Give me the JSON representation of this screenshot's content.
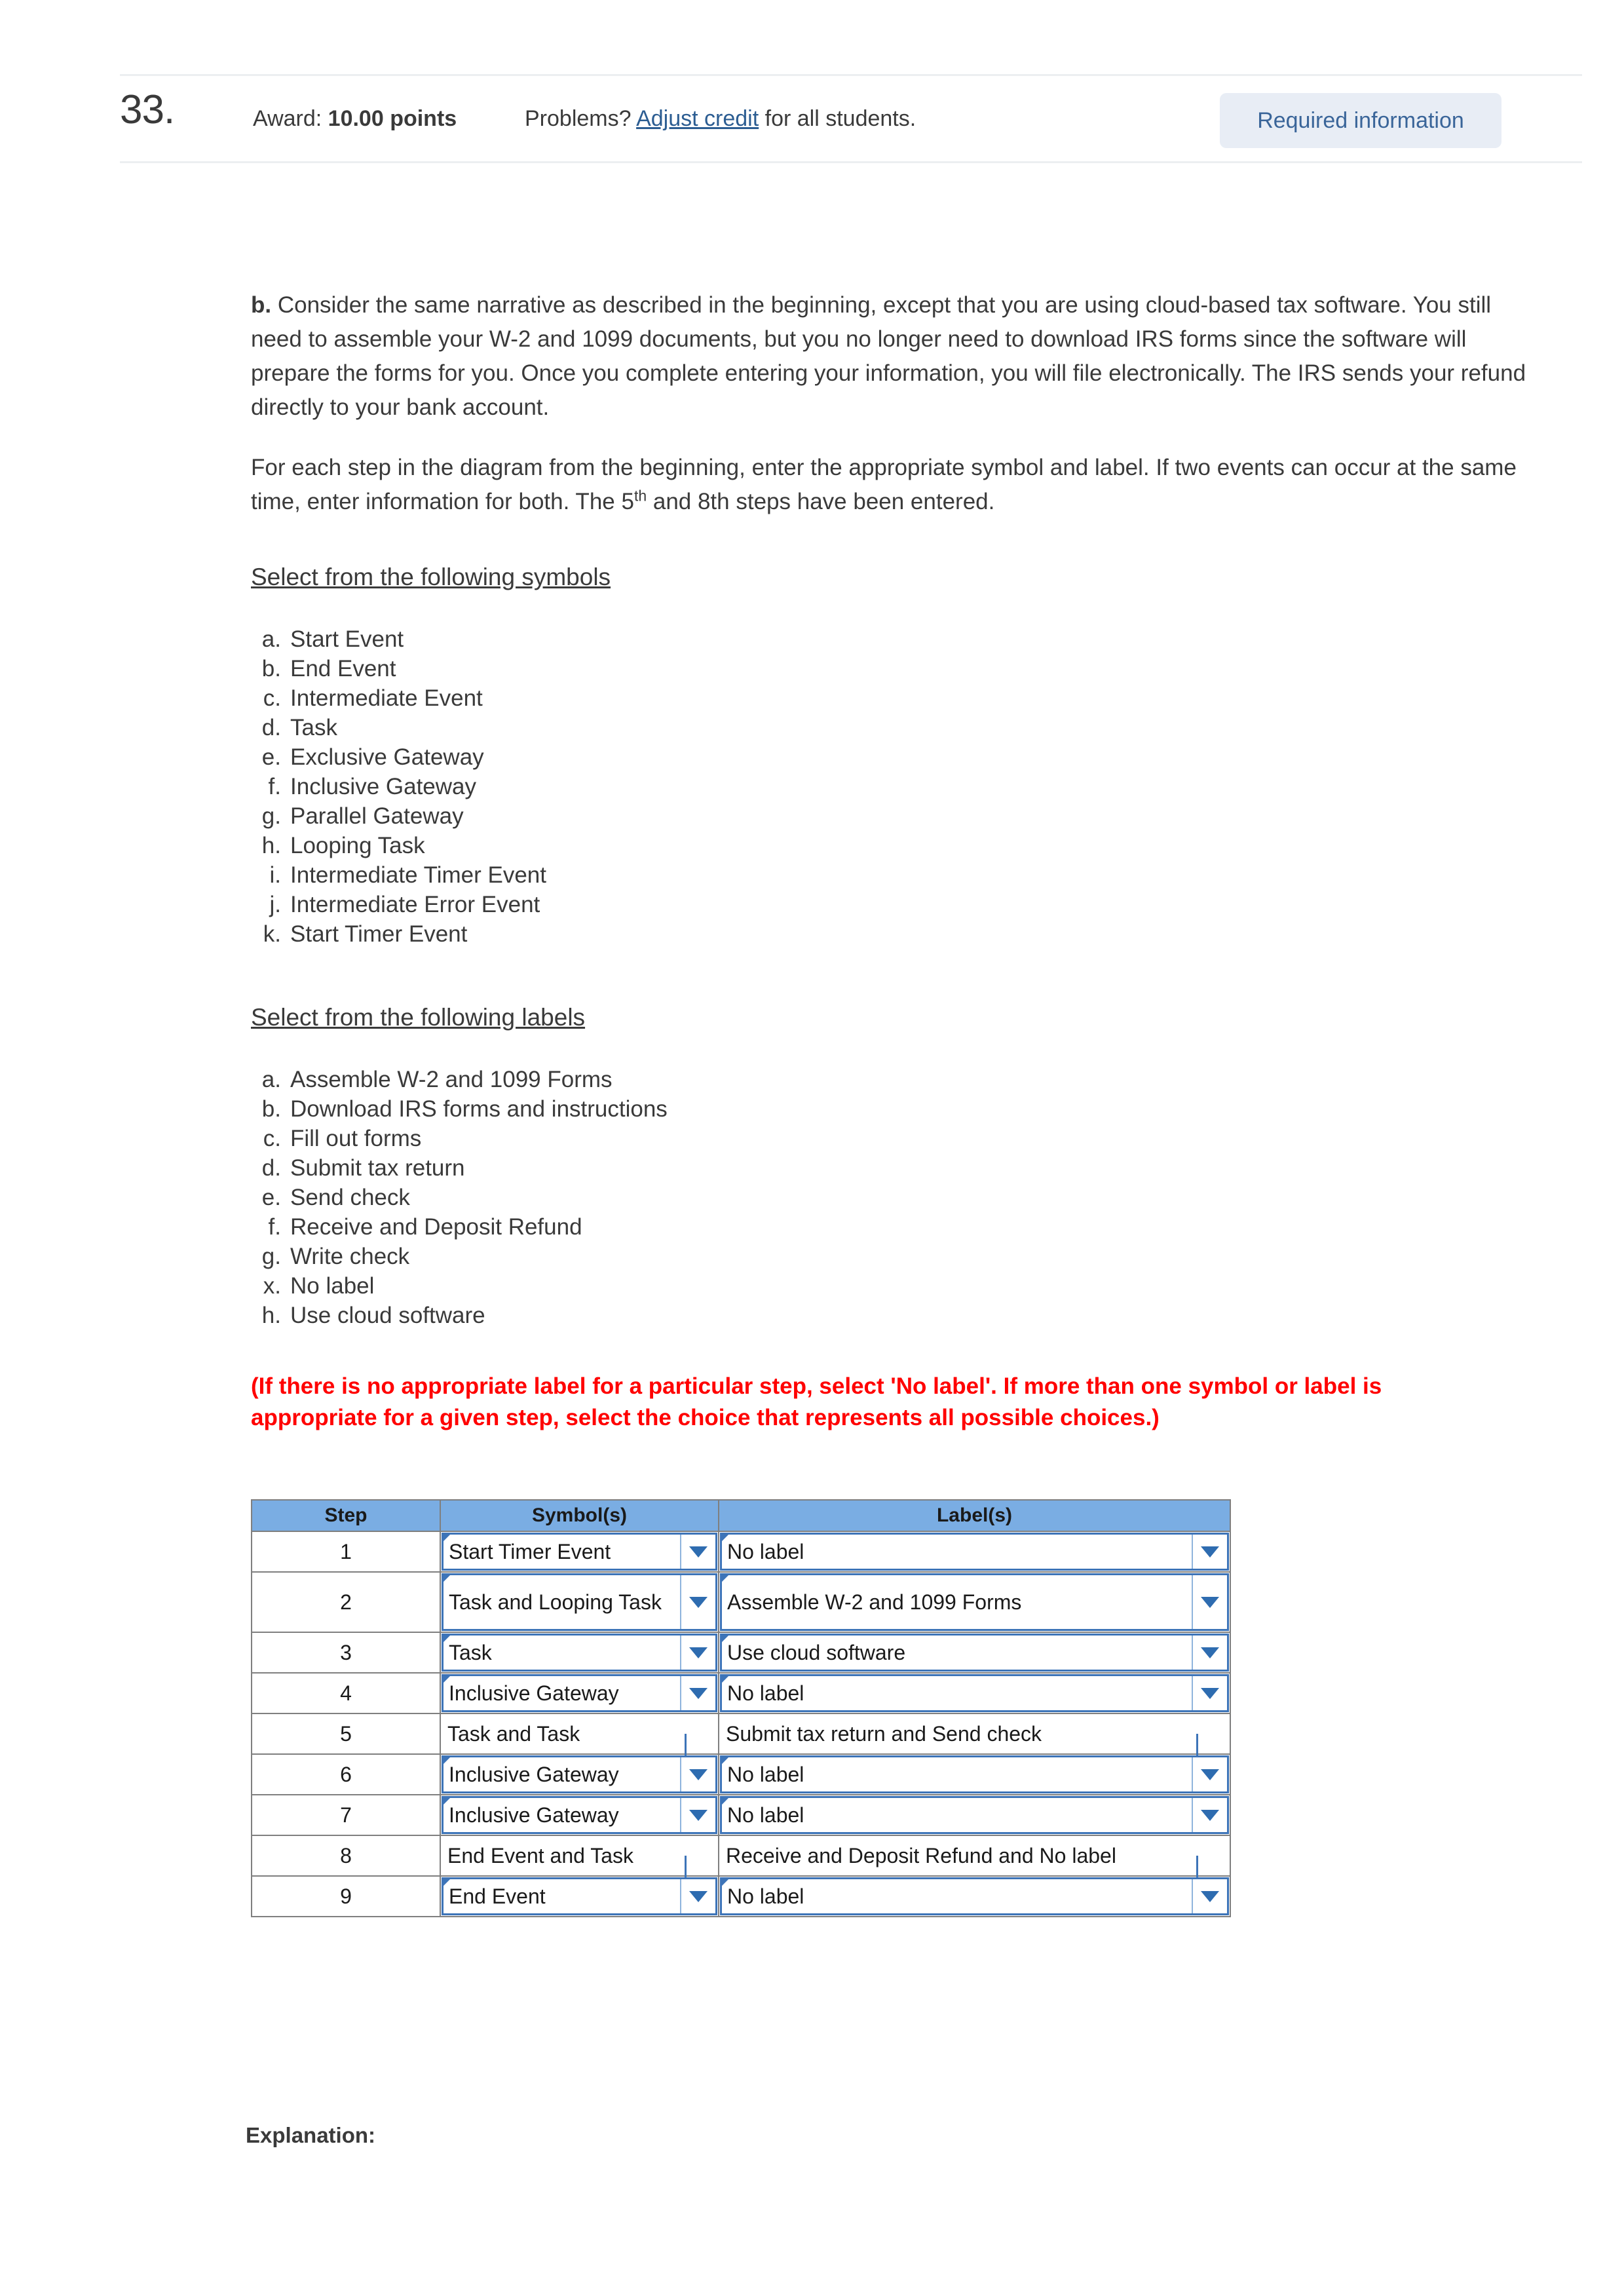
{
  "header": {
    "question_number": "33.",
    "award_prefix": "Award:",
    "award_value": "10.00 points",
    "problems_prefix": "Problems?",
    "adjust_link": "Adjust credit",
    "problems_suffix": "for all students.",
    "required_badge": "Required information",
    "badge_bg": "#E8EDF5",
    "badge_fg": "#3A6599"
  },
  "body": {
    "part_letter": "b.",
    "paragraph1": " Consider the same narrative as described in the beginning, except that you are using cloud-based tax software. You still need to assemble your W-2 and 1099 documents, but you no longer need to download IRS forms since the software will prepare the forms for you. Once you complete entering your information, you will file electronically. The IRS sends your refund directly to your bank account.",
    "paragraph2_a": "For each step in the diagram from the beginning, enter the appropriate symbol and label. If two events can occur at the same time, enter information for both. The 5",
    "paragraph2_sup": "th",
    "paragraph2_b": " and 8th steps have been entered.",
    "symbols_heading": "Select from the following symbols",
    "labels_heading": "Select from the following labels",
    "warning_line1": "(If there is no appropriate label for a particular step, select 'No label'. If more than one symbol or label is",
    "warning_line2": "appropriate for a given step, select the choice that represents all possible choices.)",
    "warning_color": "#FF0000",
    "explanation_heading": "Explanation:"
  },
  "symbol_options": [
    {
      "key": "a.",
      "text": "Start Event"
    },
    {
      "key": "b.",
      "text": "End Event"
    },
    {
      "key": "c.",
      "text": "Intermediate Event"
    },
    {
      "key": "d.",
      "text": "Task"
    },
    {
      "key": "e.",
      "text": "Exclusive Gateway"
    },
    {
      "key": "f.",
      "text": "Inclusive Gateway"
    },
    {
      "key": "g.",
      "text": "Parallel Gateway"
    },
    {
      "key": "h.",
      "text": "Looping Task"
    },
    {
      "key": "i.",
      "text": "Intermediate Timer Event"
    },
    {
      "key": "j.",
      "text": "Intermediate Error Event"
    },
    {
      "key": "k.",
      "text": "Start Timer Event"
    }
  ],
  "label_options": [
    {
      "key": "a.",
      "text": "Assemble W-2 and 1099 Forms"
    },
    {
      "key": "b.",
      "text": "Download IRS forms and instructions"
    },
    {
      "key": "c.",
      "text": "Fill out forms"
    },
    {
      "key": "d.",
      "text": "Submit tax return"
    },
    {
      "key": "e.",
      "text": "Send check"
    },
    {
      "key": "f.",
      "text": "Receive and Deposit Refund"
    },
    {
      "key": "g.",
      "text": "Write check"
    },
    {
      "key": "x.",
      "text": "No label"
    },
    {
      "key": "h.",
      "text": "Use cloud software"
    }
  ],
  "table": {
    "header_bg": "#7AADE3",
    "columns": [
      "Step",
      "Symbol(s)",
      "Label(s)"
    ],
    "rows": [
      {
        "step": "1",
        "symbol": "Start Timer Event",
        "label": "No label",
        "editable": true,
        "tall": false
      },
      {
        "step": "2",
        "symbol": "Task and Looping Task",
        "label": "Assemble W-2 and 1099 Forms",
        "editable": true,
        "tall": true
      },
      {
        "step": "3",
        "symbol": "Task",
        "label": "Use cloud software",
        "editable": true,
        "tall": false
      },
      {
        "step": "4",
        "symbol": "Inclusive Gateway",
        "label": "No label",
        "editable": true,
        "tall": false
      },
      {
        "step": "5",
        "symbol": "Task and Task",
        "label": "Submit tax return and Send check",
        "editable": false,
        "tall": false
      },
      {
        "step": "6",
        "symbol": "Inclusive Gateway",
        "label": "No label",
        "editable": true,
        "tall": false
      },
      {
        "step": "7",
        "symbol": "Inclusive Gateway",
        "label": "No label",
        "editable": true,
        "tall": false
      },
      {
        "step": "8",
        "symbol": "End Event and Task",
        "label": "Receive and Deposit Refund and No label",
        "editable": false,
        "tall": false
      },
      {
        "step": "9",
        "symbol": "End Event",
        "label": "No label",
        "editable": true,
        "tall": false
      }
    ]
  }
}
